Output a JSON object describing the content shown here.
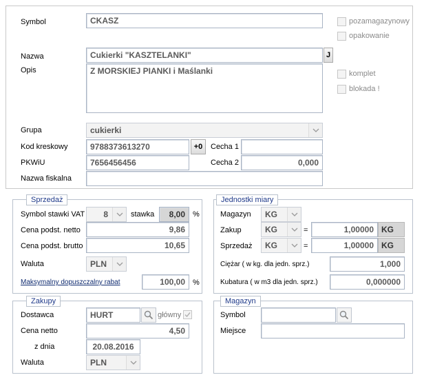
{
  "general": {
    "symbol_label": "Symbol",
    "symbol_value": "CKASZ",
    "nazwa_label": "Nazwa",
    "nazwa_value": "Cukierki \"KASZTELANKI\"",
    "nazwa_button": "J",
    "opis_label": "Opis",
    "opis_value": "Z MORSKIEJ PIANKI i Maślanki",
    "grupa_label": "Grupa",
    "grupa_value": "cukierki",
    "kod_label": "Kod kreskowy",
    "kod_value": "9788373613270",
    "kod_button": "+0",
    "cecha1_label": "Cecha 1",
    "cecha1_value": "",
    "pkwiu_label": "PKWiU",
    "pkwiu_value": "7656456456",
    "cecha2_label": "Cecha 2",
    "cecha2_value": "0,000",
    "fiskalna_label": "Nazwa fiskalna",
    "fiskalna_value": ""
  },
  "options": {
    "pozamagazynowy": "pozamagazynowy",
    "opakowanie": "opakowanie",
    "komplet": "komplet",
    "blokada": "blokada !"
  },
  "sprzedaz": {
    "title": "Sprzedaż",
    "vat_label": "Symbol stawki VAT",
    "vat_value": "8",
    "stawka_label": "stawka",
    "stawka_value": "8,00",
    "percent": "%",
    "netto_label": "Cena podst. netto",
    "netto_value": "9,86",
    "brutto_label": "Cena podst. brutto",
    "brutto_value": "10,65",
    "waluta_label": "Waluta",
    "waluta_value": "PLN",
    "rabat_label": "Maksymalny dopuszczalny rabat",
    "rabat_value": "100,00",
    "rabat_percent": "%"
  },
  "jednostki": {
    "title": "Jednostki miary",
    "magazyn_label": "Magazyn",
    "magazyn_value": "KG",
    "zakup_label": "Zakup",
    "zakup_unit": "KG",
    "zakup_eq": "=",
    "zakup_value": "1,00000",
    "zakup_base": "KG",
    "sprzedaz_label": "Sprzedaż",
    "sprzedaz_unit": "KG",
    "sprzedaz_eq": "=",
    "sprzedaz_value": "1,00000",
    "sprzedaz_base": "KG",
    "ciezar_label": "Ciężar ( w kg. dla jedn. sprz.)",
    "ciezar_value": "1,000",
    "kubatura_label": "Kubatura  ( w m3 dla jedn. sprz.)",
    "kubatura_value": "0,000000"
  },
  "zakupy": {
    "title": "Zakupy",
    "dostawca_label": "Dostawca",
    "dostawca_value": "HURT",
    "glowny_label": "główny",
    "cena_label": "Cena netto",
    "cena_value": "4,50",
    "data_label": "z dnia",
    "data_value": "20.08.2016",
    "waluta_label": "Waluta",
    "waluta_value": "PLN"
  },
  "magazyn": {
    "title": "Magazyn",
    "symbol_label": "Symbol",
    "symbol_value": "",
    "miejsce_label": "Miejsce",
    "miejsce_value": ""
  }
}
